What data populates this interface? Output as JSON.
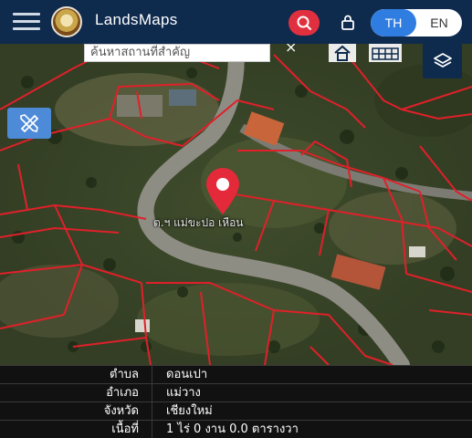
{
  "header": {
    "app_name": "LandsMaps",
    "logo_icon": "land-department-seal-icon",
    "menu_icon": "hamburger-icon",
    "search_icon": "search-icon",
    "lock_icon": "lock-icon",
    "languages": [
      {
        "label": "TH",
        "active": true
      },
      {
        "label": "EN",
        "active": false
      }
    ],
    "accent_color": "#0e2a4d",
    "search_button_color": "#e0303f",
    "active_language_color": "#2f7de1"
  },
  "map": {
    "search_input_value": "ค้นหาสถานที่สำคัญ",
    "clear_label": "×",
    "parcel_label": "ต.ฯ แม่ขะปอ เหือน",
    "pin_color": "#e4293a",
    "parcel_border_color": "#e0202a",
    "controls": {
      "home_icon": "home-icon",
      "grid_icon": "grid-icon",
      "layers_icon": "layers-icon",
      "draw_icon": "ruler-pencil-icon"
    }
  },
  "info": {
    "rows": [
      {
        "label": "ตำบล",
        "value": "ดอนเปา"
      },
      {
        "label": "อำเภอ",
        "value": "แม่วาง"
      },
      {
        "label": "จังหวัด",
        "value": "เชียงใหม่"
      },
      {
        "label": "เนื้อที่",
        "value": "1 ไร่ 0 งาน 0.0 ตารางวา"
      }
    ]
  }
}
